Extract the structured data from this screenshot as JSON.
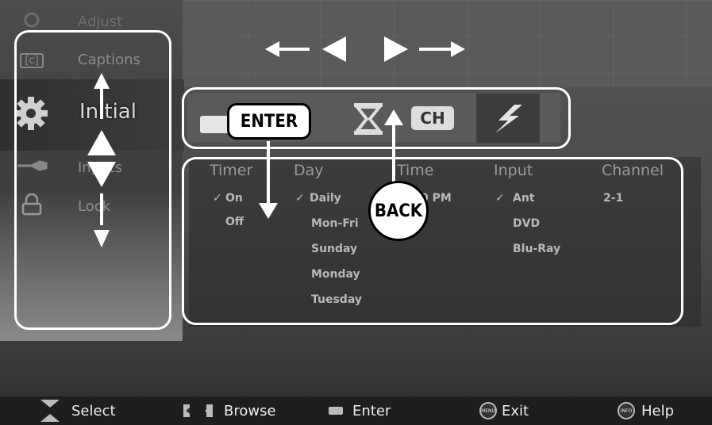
{
  "side_menu": {
    "items": [
      {
        "label": "Adjust",
        "icon": "adjust-icon"
      },
      {
        "label": "Captions",
        "icon": "captions-icon",
        "icon_text": "[c]"
      },
      {
        "label": "Initial",
        "icon": "gear-icon"
      },
      {
        "label": "Inputs",
        "icon": "input-cable-icon"
      },
      {
        "label": "Lock",
        "icon": "lock-icon"
      }
    ]
  },
  "tabs": {
    "items": [
      {
        "name": "tab-sleep",
        "icon": "hourglass-icon"
      },
      {
        "name": "tab-channel",
        "icon": "ch-icon",
        "text": "CH"
      },
      {
        "name": "tab-power",
        "icon": "lightning-icon"
      }
    ]
  },
  "table": {
    "headers": [
      "Timer",
      "Day",
      "Time",
      "Input",
      "Channel"
    ],
    "timer": [
      {
        "text": "On",
        "checked": true
      },
      {
        "text": "Off",
        "checked": false
      }
    ],
    "day": [
      {
        "text": "Daily",
        "checked": true
      },
      {
        "text": "Mon-Fri",
        "checked": false
      },
      {
        "text": "Sunday",
        "checked": false
      },
      {
        "text": "Monday",
        "checked": false
      },
      {
        "text": "Tuesday",
        "checked": false
      }
    ],
    "time": "0 PM",
    "input": [
      {
        "text": "Ant",
        "checked": true
      },
      {
        "text": "DVD",
        "checked": false
      },
      {
        "text": "Blu-Ray",
        "checked": false
      }
    ],
    "channel": "2-1"
  },
  "overlay": {
    "enter_badge": "ENTER",
    "back_badge": "BACK"
  },
  "bottom_bar": {
    "select": "Select",
    "browse": "Browse",
    "enter": "Enter",
    "exit": "Exit",
    "exit_icon_text": "MENU",
    "help": "Help",
    "help_icon_text": "INFO"
  },
  "colors": {
    "frame": "#ffffff",
    "background": "#4d4d4d",
    "bottom_bar": "#1e1e1e"
  }
}
